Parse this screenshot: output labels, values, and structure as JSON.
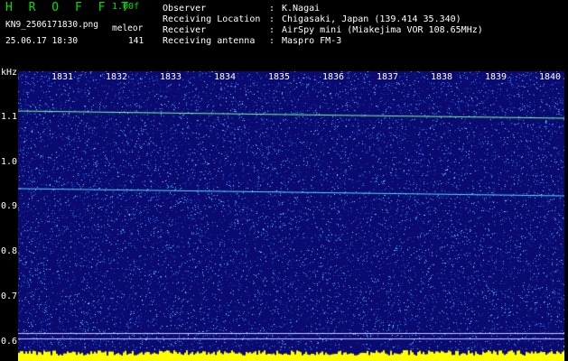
{
  "header": {
    "app_title": "H R O F F T",
    "version": "1.00f",
    "file_name": "KN9_2506171830.png",
    "mode": "meleor",
    "date_time": "25.06.17 18:30",
    "count": "141",
    "fields": [
      {
        "label": "Observer",
        "sep": ":",
        "value": "K.Nagai"
      },
      {
        "label": "Receiving Location",
        "sep": ":",
        "value": "Chigasaki, Japan (139.414 35.340)"
      },
      {
        "label": "Receiver",
        "sep": ":",
        "value": "AirSpy mini (Miakejima VOR 108.65MHz)"
      },
      {
        "label": "Receiving antenna",
        "sep": ":",
        "value": "Maspro FM-3"
      }
    ]
  },
  "y_axis": {
    "unit": "kHz",
    "ticks": [
      "1.1",
      "1.0",
      "0.9",
      "0.8",
      "0.7",
      "0.6"
    ]
  },
  "x_axis": {
    "ticks": [
      "1831",
      "1832",
      "1833",
      "1834",
      "1835",
      "1836",
      "1837",
      "1838",
      "1839",
      "1840"
    ]
  },
  "colors": {
    "background": "#0a0a70",
    "noise": "#4aa8ff",
    "signal": "#7dff9a",
    "bottom_bar": "#ffff00"
  }
}
